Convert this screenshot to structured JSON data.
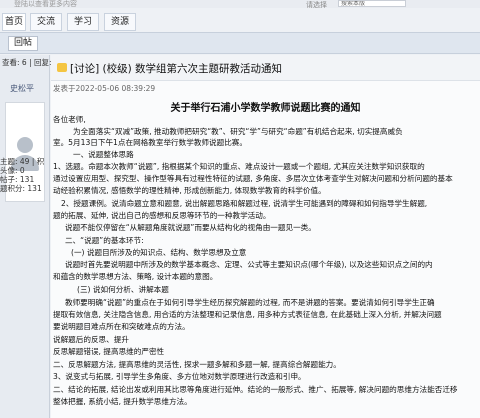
{
  "topbar": {
    "hint": "登陆以查看更多内容",
    "input_label": "请选择",
    "search": "搜索本版"
  },
  "nav": {
    "tabs": [
      "首页",
      "交流",
      "学习",
      "资源"
    ]
  },
  "strip": {
    "back_label": "回帖"
  },
  "sidebar": {
    "stats": "查看: 6 | 回复: 1",
    "author": "史松平",
    "info": [
      "主题: 49 | 积",
      "头像: 0",
      "帖子: 131",
      "题积分: 131"
    ]
  },
  "post": {
    "title": "[讨论] (校级) 数学组第六次主题研教活动通知",
    "date": "发表于2022-05-06 08:39:29",
    "doc_title": "关于举行石浦小学数学教师说题比赛的通知",
    "lines": [
      "各位老师,",
      "为全面落实“双减”政策, 推动教师把研究“教”、研究“学”与研究“命题”有机结合起来, 切实提高威负",
      "室。5月13日下午1点在网格教室举行数学教师说题比赛。",
      "一、说题整体思路",
      "1、选题。命题本次教师“说题”, 指根据某个知识的重点、难点设计一题或一个题组, 尤其应关注数学知识获取的",
      "通过设置应用型、探究型、操作型等具有过程性特征的试题, 多角度、多层次立体考查学生对解决问题和分析问题的基本",
      "动经验积累情况, 感悟数学的理性精神, 形成创新能力, 体现数学教育的科学价值。",
      "2、授题课例。说清命题立意和题意, 说出解题思路和解题过程, 说清学生可能遇到的障碍和如何指导学生解题,",
      "题的拓展、延伸, 说出自己的感想和反思等环节的一种教学活动。",
      "说题不能仅停留在“从解题角度就说题”而要从结构化的视角由一题见一类。",
      "二、“说题”的基本环节:",
      "(一) 说题目所涉及的知识点、结构、数学思想及立意",
      "说题时首先要说明题中所涉及的数学基本概念、定理、公式等主要知识点(哪个年级), 以及这些知识点之间的内",
      "和蕴含的数学思想方法、策略, 设计本题的意图。",
      "(三) 说如何分析、讲解本题",
      "教师要明确“说题”的重点在于如何引导学生经历探究解题的过程, 而不是讲题的答案。要说清如何引导学生正确",
      "提取有效信息, 关注隐含信息, 用合适的方法整理和记录信息, 用多种方式表征信息, 在此基础上深入分析, 并解决问题",
      "要说明题目难点所在和突破难点的方法。",
      "说解题后的反思、提升",
      "反思解题错误, 提高思维的严密性",
      "二、反思解题方法, 提高思维的灵活性, 探求一题多解和多题一解, 提高综合解题能力。",
      "3、说变式与拓展, 引导学生多角度、多方位地对数学原理进行改造和引申。",
      "二、结论的拓展, 结论出发或利用其比思等角度进行延伸。结论的一般形式、推广、拓展等, 解决问题的思维方法能否迁移",
      "整体把握, 系统小结, 提升数学思维方法。"
    ]
  }
}
